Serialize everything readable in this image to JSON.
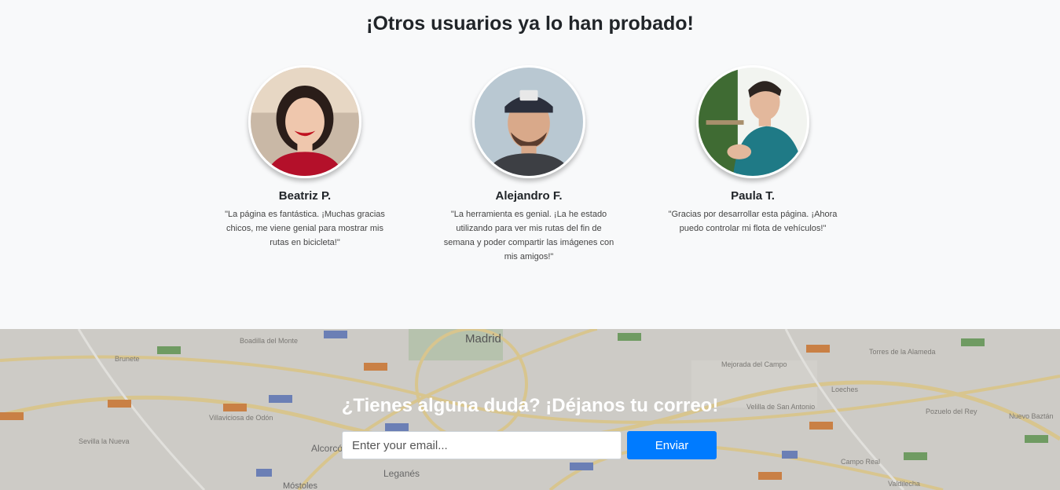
{
  "testimonials": {
    "title": "¡Otros usuarios ya lo han probado!",
    "items": [
      {
        "name": "Beatriz P.",
        "quote": "\"La página es fantástica. ¡Muchas gracias chicos, me viene genial para mostrar mis rutas en bicicleta!\""
      },
      {
        "name": "Alejandro F.",
        "quote": "\"La herramienta es genial. ¡La he estado utilizando para ver mis rutas del fin de semana y poder compartir las imágenes con mis amigos!\""
      },
      {
        "name": "Paula T.",
        "quote": "\"Gracias por desarrollar esta página. ¡Ahora puedo controlar mi flota de vehículos!\""
      }
    ]
  },
  "cta": {
    "title": "¿Tienes alguna duda? ¡Déjanos tu correo!",
    "email_placeholder": "Enter your email...",
    "send_label": "Enviar",
    "button_color": "#007bff",
    "map_labels": [
      "Madrid",
      "Leganés",
      "Alcorcón",
      "Móstoles",
      "Boadilla del Monte",
      "Villaviciosa de Odón",
      "Torres de la Alameda",
      "Loeches",
      "Mejorada del Campo",
      "Velilla de San Antonio",
      "Pozuelo del Rey",
      "Nuevo Baztán",
      "Campo Real",
      "Sevilla la Nueva",
      "Brunete",
      "Valdilecha"
    ]
  }
}
